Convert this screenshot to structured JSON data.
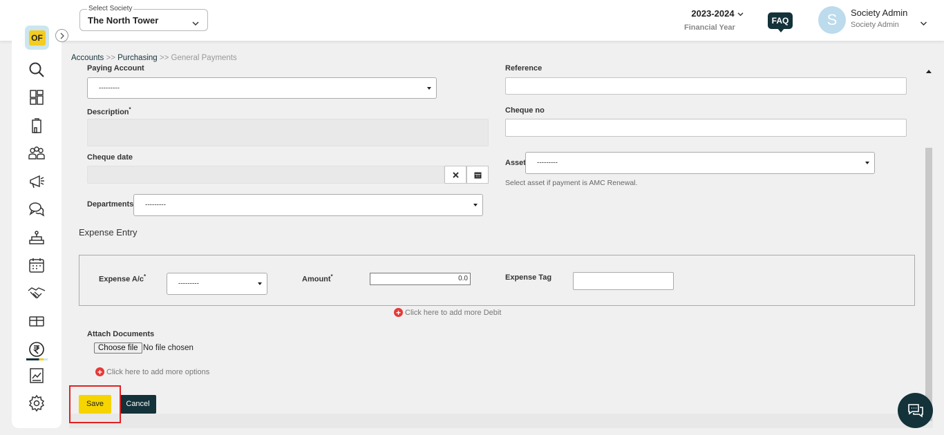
{
  "header": {
    "society_caption": "Select Society",
    "society_value": "The North Tower",
    "financial_year": "2023-2024",
    "financial_year_label": "Financial Year",
    "faq_label": "FAQ",
    "avatar_initial": "S",
    "user_name": "Society Admin",
    "user_role": "Society Admin"
  },
  "breadcrumb": {
    "item1": "Accounts",
    "sep1": " >> ",
    "item2": "Purchasing",
    "sep2": " >> ",
    "item3": "General Payments"
  },
  "sidebar": {
    "logo_text": "OF",
    "items": [
      "search-icon",
      "dashboard-icon",
      "building-icon",
      "members-icon",
      "announcement-icon",
      "messages-icon",
      "amenity-icon",
      "calendar-icon",
      "handshake-icon",
      "assets-icon",
      "accounts-icon",
      "reports-icon",
      "settings-icon"
    ],
    "active": "accounts-icon"
  },
  "form": {
    "paying_account_label": "Paying Account",
    "paying_account_value": "---------",
    "reference_label": "Reference",
    "reference_value": "",
    "description_label": "Description",
    "description_value": "",
    "cheque_no_label": "Cheque no",
    "cheque_no_value": "",
    "cheque_date_label": "Cheque date",
    "cheque_date_value": "",
    "asset_label": "Asset",
    "asset_value": "---------",
    "asset_hint": "Select asset if payment is AMC Renewal.",
    "departments_label": "Departments",
    "departments_value": "---------",
    "required_mark": "*"
  },
  "expense": {
    "section_title": "Expense Entry",
    "expense_ac_label": "Expense A/c",
    "expense_ac_value": "---------",
    "amount_label": "Amount",
    "amount_value": "0.0",
    "expense_tag_label": "Expense Tag",
    "expense_tag_value": "",
    "add_debit": "Click here to add more Debit"
  },
  "attachments": {
    "label": "Attach Documents",
    "choose_file": "Choose file",
    "no_file": "No file chosen",
    "add_options": "Click here to add more options"
  },
  "actions": {
    "save_label": "Save",
    "cancel_label": "Cancel"
  },
  "colors": {
    "brand_dark": "#13323a",
    "accent_yellow": "#f5d400",
    "highlight_red": "#e02020"
  }
}
